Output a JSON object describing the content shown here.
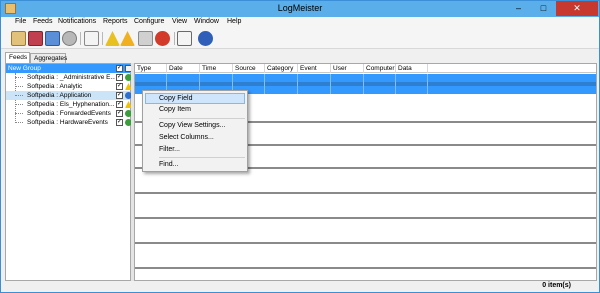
{
  "window": {
    "title": "LogMeister",
    "minimize": "–",
    "maximize": "□",
    "close": "✕"
  },
  "menu": [
    "File",
    "Feeds",
    "Notifications",
    "Reports",
    "Configure",
    "View",
    "Window",
    "Help"
  ],
  "toolbar": {
    "icons": [
      "new-feed-icon",
      "open-icon",
      "properties-icon",
      "refresh-icon",
      "checklist-icon",
      "warning-filter-icon",
      "error-filter-icon",
      "delete-icon",
      "clear-icon",
      "add-window-icon",
      "help-icon"
    ]
  },
  "tabs": {
    "feeds": "Feeds",
    "aggregates": "Aggregates"
  },
  "tree": {
    "group": "New Group",
    "header_check": "✓",
    "items": [
      {
        "label": "Softpedia : _Administrative E...",
        "check": "✓",
        "status": "ok"
      },
      {
        "label": "Softpedia : Analytic",
        "check": "✓",
        "status": "warn"
      },
      {
        "label": "Softpedia : Application",
        "check": "✓",
        "status": "info"
      },
      {
        "label": "Softpedia : Els_Hyphenation...",
        "check": "✓",
        "status": "warn"
      },
      {
        "label": "Softpedia : ForwardedEvents",
        "check": "✓",
        "status": "ok"
      },
      {
        "label": "Softpedia : HardwareEvents",
        "check": "✓",
        "status": "ok"
      }
    ]
  },
  "grid": {
    "columns": [
      "Type",
      "Date",
      "Time",
      "Source",
      "Category",
      "Event",
      "User",
      "Computer",
      "Data"
    ]
  },
  "context_menu": {
    "items": [
      "Copy Field",
      "Copy Item",
      "Copy View Settings...",
      "Select Columns...",
      "Filter...",
      "Find..."
    ]
  },
  "status": {
    "count": "0 item(s)"
  },
  "colors": {
    "titlebar": "#5aaee9",
    "selection": "#3399ff",
    "close": "#c7382e"
  }
}
